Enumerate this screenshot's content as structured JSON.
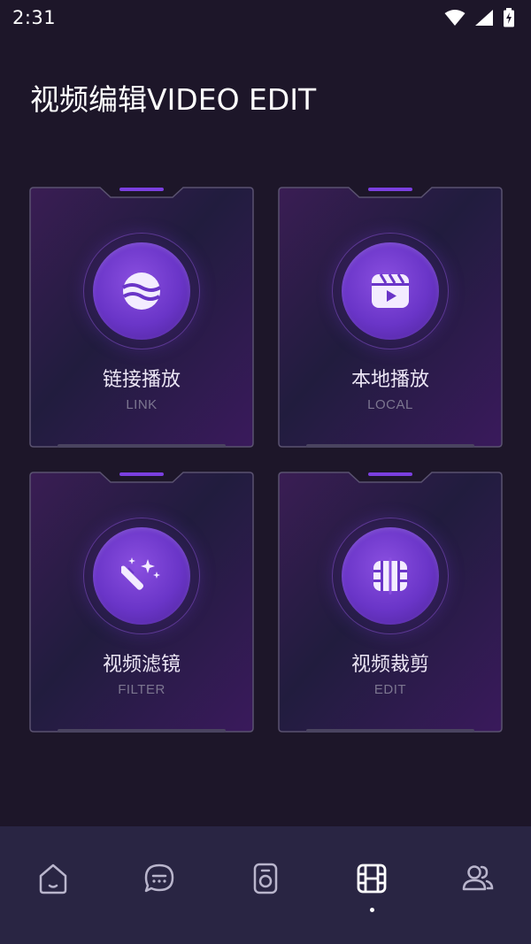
{
  "status_bar": {
    "time": "2:31"
  },
  "page": {
    "title": "视频编辑VIDEO EDIT"
  },
  "cards": [
    {
      "title": "链接播放",
      "subtitle": "LINK",
      "icon": "planet-icon"
    },
    {
      "title": "本地播放",
      "subtitle": "LOCAL",
      "icon": "video-clapper-icon"
    },
    {
      "title": "视频滤镜",
      "subtitle": "FILTER",
      "icon": "magic-wand-icon"
    },
    {
      "title": "视频裁剪",
      "subtitle": "EDIT",
      "icon": "film-cut-icon"
    }
  ],
  "bottom_nav": {
    "items": [
      {
        "icon": "home-icon",
        "active": false
      },
      {
        "icon": "chat-icon",
        "active": false
      },
      {
        "icon": "speaker-icon",
        "active": false
      },
      {
        "icon": "film-icon",
        "active": true
      },
      {
        "icon": "users-icon",
        "active": false
      }
    ]
  },
  "colors": {
    "background": "#1d1629",
    "nav_background": "#292543",
    "accent": "#6a35c8",
    "accent_bar": "#7b3fe0"
  }
}
